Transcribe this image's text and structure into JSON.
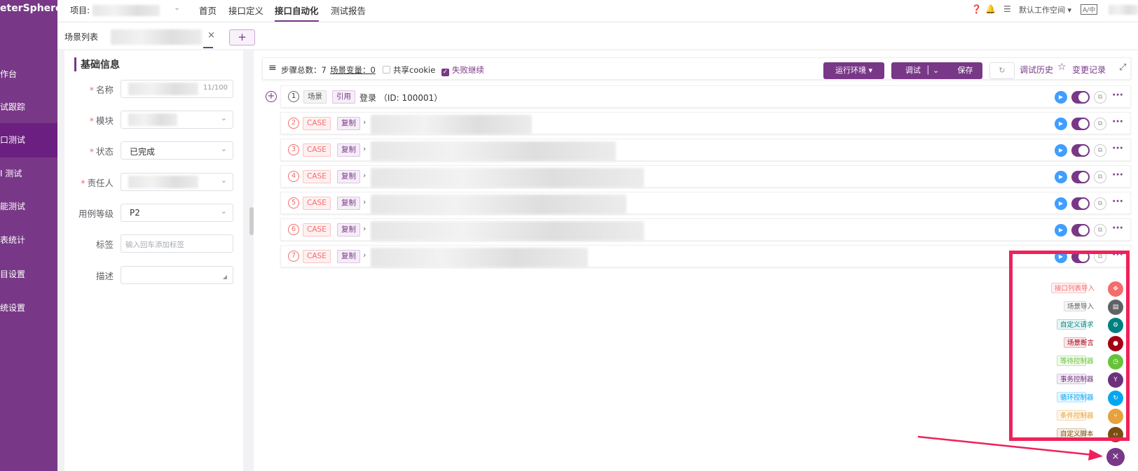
{
  "sidebar": {
    "brand": "eterSphere",
    "items": [
      {
        "label": "作台"
      },
      {
        "label": "试跟踪"
      },
      {
        "label": "口测试"
      },
      {
        "label": "I 测试"
      },
      {
        "label": "能测试"
      },
      {
        "label": "表统计"
      },
      {
        "label": "目设置"
      },
      {
        "label": "统设置"
      }
    ]
  },
  "header": {
    "project_label": "项目:",
    "nav": [
      {
        "label": "首页"
      },
      {
        "label": "接口定义"
      },
      {
        "label": "接口自动化"
      },
      {
        "label": "测试报告"
      }
    ],
    "workspace": "默认工作空间",
    "lang": "A/中"
  },
  "tabs": {
    "list_label": "场景列表",
    "close": "×",
    "add": "+"
  },
  "form": {
    "section_title": "基础信息",
    "name_label": "名称",
    "name_count": "11/100",
    "module_label": "模块",
    "status_label": "状态",
    "status_value": "已完成",
    "owner_label": "责任人",
    "level_label": "用例等级",
    "level_value": "P2",
    "tag_label": "标签",
    "tag_placeholder": "输入回车添加标签",
    "desc_label": "描述",
    "required_mark": "*"
  },
  "toolbar": {
    "steps_total": "步骤总数：7",
    "scene_vars": "场景变量：0",
    "share_cookie": "共享cookie",
    "fail_continue": "失败继续",
    "env_button": "运行环境",
    "debug_button": "调试",
    "save_button": "保存",
    "debug_history": "调试历史",
    "change_log": "变更记录"
  },
  "steps": [
    {
      "num": "1",
      "type_tag": "场景",
      "ref_tag": "引用",
      "name": "登录 （ID: 100001）"
    },
    {
      "num": "2",
      "type_tag": "CASE",
      "ref_tag": "复制"
    },
    {
      "num": "3",
      "type_tag": "CASE",
      "ref_tag": "复制"
    },
    {
      "num": "4",
      "type_tag": "CASE",
      "ref_tag": "复制"
    },
    {
      "num": "5",
      "type_tag": "CASE",
      "ref_tag": "复制"
    },
    {
      "num": "6",
      "type_tag": "CASE",
      "ref_tag": "复制"
    },
    {
      "num": "7",
      "type_tag": "CASE",
      "ref_tag": "复制"
    }
  ],
  "float_menu": {
    "items": [
      {
        "label": "接口列表导入",
        "color": "#f56c6c"
      },
      {
        "label": "场景导入",
        "color": "#606266"
      },
      {
        "label": "自定义请求",
        "color": "#008080"
      },
      {
        "label": "场景断言",
        "color": "#a30014"
      },
      {
        "label": "等待控制器",
        "color": "#67c23a"
      },
      {
        "label": "事务控制器",
        "color": "#6d317c"
      },
      {
        "label": "循环控制器",
        "color": "#02a7f0"
      },
      {
        "label": "条件控制器",
        "color": "#e6a23c"
      },
      {
        "label": "自定义脚本",
        "color": "#7b4d12"
      }
    ],
    "close": "×"
  }
}
